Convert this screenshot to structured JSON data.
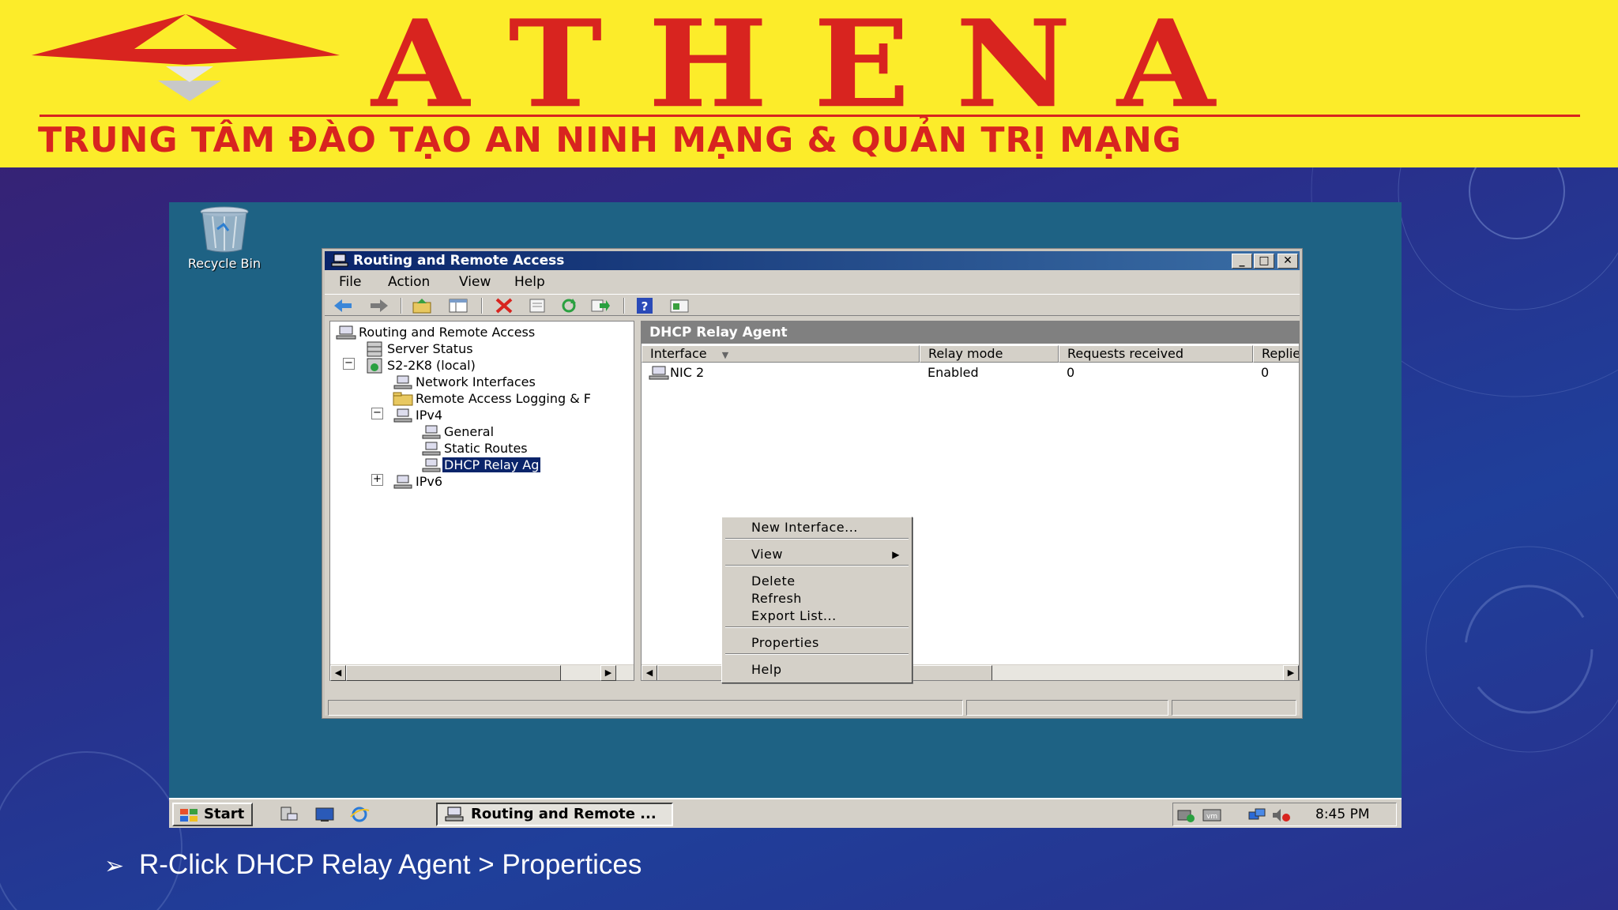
{
  "banner": {
    "brand": "ATHENA",
    "slogan": "TRUNG TÂM ĐÀO TẠO AN NINH MẠNG & QUẢN TRỊ MẠNG",
    "colors": {
      "background": "#fcec2a",
      "text": "#d8241f"
    }
  },
  "desktop": {
    "recycle_bin_label": "Recycle Bin"
  },
  "window": {
    "title": "Routing and Remote Access",
    "controls": {
      "minimize": "_",
      "maximize": "□",
      "close": "✕"
    },
    "menu": [
      "File",
      "Action",
      "View",
      "Help"
    ],
    "toolbar_icons": [
      "back-icon",
      "forward-icon",
      "up-folder-icon",
      "show-hide-tree-icon",
      "delete-icon",
      "properties-icon",
      "refresh-icon",
      "export-list-icon",
      "help-icon",
      "console-icon"
    ],
    "tree": [
      {
        "label": "Routing and Remote Access",
        "icon": "server-icon"
      },
      {
        "label": "Server Status",
        "icon": "server-status-icon"
      },
      {
        "label": "S2-2K8 (local)",
        "icon": "server-local-icon",
        "expander": "−"
      },
      {
        "label": "Network Interfaces",
        "icon": "network-icon"
      },
      {
        "label": "Remote Access Logging & F",
        "icon": "folder-icon"
      },
      {
        "label": "IPv4",
        "icon": "network-icon",
        "expander": "−"
      },
      {
        "label": "General",
        "icon": "network-icon"
      },
      {
        "label": "Static Routes",
        "icon": "network-icon"
      },
      {
        "label": "DHCP Relay Ag",
        "icon": "network-icon",
        "selected": true
      },
      {
        "label": "IPv6",
        "icon": "network-icon",
        "expander": "+"
      }
    ],
    "details": {
      "header": "DHCP Relay Agent",
      "columns": [
        "Interface",
        "Relay mode",
        "Requests received",
        "Replie"
      ],
      "rows": [
        {
          "interface": "NIC 2",
          "relay_mode": "Enabled",
          "requests_received": "0",
          "replies": "0"
        }
      ]
    },
    "context_menu": {
      "items": [
        "New Interface...",
        "View",
        "Delete",
        "Refresh",
        "Export List...",
        "Properties",
        "Help"
      ]
    }
  },
  "taskbar": {
    "start_label": "Start",
    "task_label": "Routing and Remote ...",
    "clock": "8:45 PM"
  },
  "caption": {
    "bullet": "➢",
    "text": "R-Click DHCP Relay Agent > Propertices"
  }
}
